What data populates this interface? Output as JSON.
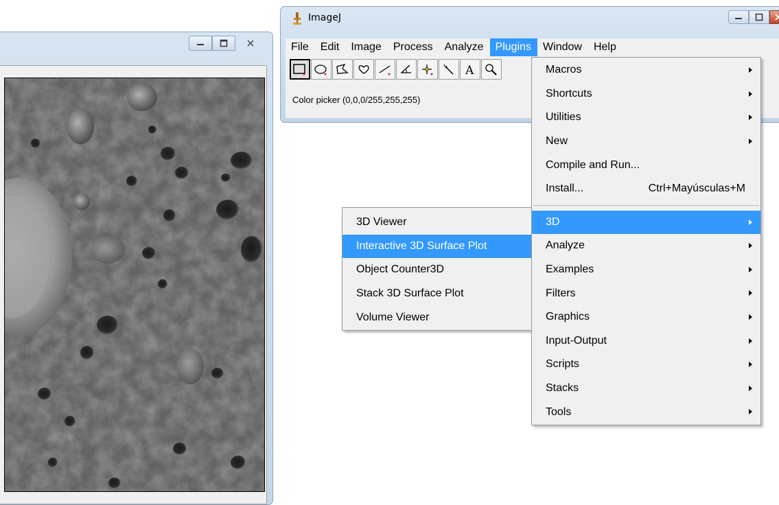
{
  "image_window": {
    "controls": [
      "minimize-icon",
      "maximize-icon",
      "close-icon"
    ]
  },
  "imagej_window": {
    "title": "ImageJ",
    "menubar": [
      "File",
      "Edit",
      "Image",
      "Process",
      "Analyze",
      "Plugins",
      "Window",
      "Help"
    ],
    "active_menu": "Plugins",
    "toolbar_tools": [
      "rectangle-tool",
      "oval-tool",
      "polygon-tool",
      "freehand-tool",
      "line-tool",
      "angle-tool",
      "point-tool",
      "wand-tool",
      "text-tool",
      "magnifier-tool"
    ],
    "status": "Color picker (0,0,0/255,255,255)"
  },
  "plugins_menu": {
    "items": [
      {
        "label": "Macros",
        "submenu": true
      },
      {
        "label": "Shortcuts",
        "submenu": true
      },
      {
        "label": "Utilities",
        "submenu": true
      },
      {
        "label": "New",
        "submenu": true
      },
      {
        "label": "Compile and Run...",
        "submenu": false
      },
      {
        "label": "Install...",
        "accelerator": "Ctrl+Mayúsculas+M",
        "submenu": false
      },
      {
        "label": "3D",
        "submenu": true,
        "highlighted": true
      },
      {
        "label": "Analyze",
        "submenu": true
      },
      {
        "label": "Examples",
        "submenu": true
      },
      {
        "label": "Filters",
        "submenu": true
      },
      {
        "label": "Graphics",
        "submenu": true
      },
      {
        "label": "Input-Output",
        "submenu": true
      },
      {
        "label": "Scripts",
        "submenu": true
      },
      {
        "label": "Stacks",
        "submenu": true
      },
      {
        "label": "Tools",
        "submenu": true
      }
    ]
  },
  "submenu_3d": {
    "items": [
      {
        "label": "3D Viewer"
      },
      {
        "label": "Interactive 3D Surface Plot",
        "highlighted": true
      },
      {
        "label": "Object Counter3D"
      },
      {
        "label": "Stack 3D Surface Plot"
      },
      {
        "label": "Volume Viewer"
      }
    ]
  },
  "colors": {
    "highlight": "#3399ff",
    "menu_bg": "#f0f0f0",
    "title_bar": "#c8d9ec"
  }
}
